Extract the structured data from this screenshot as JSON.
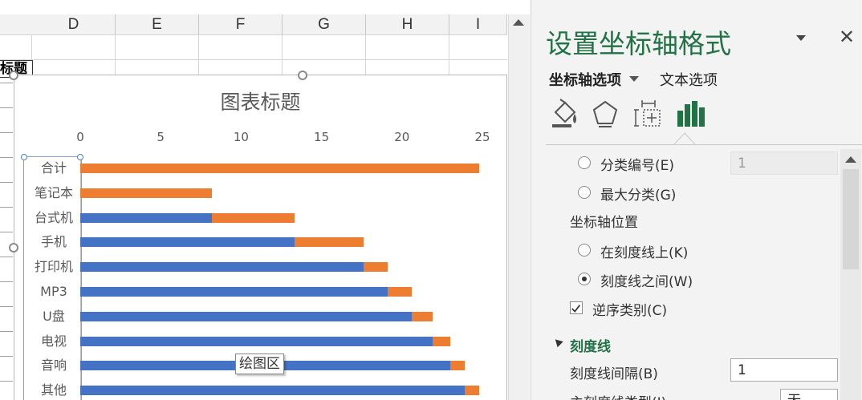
{
  "sheet": {
    "columns": [
      "D",
      "E",
      "F",
      "G",
      "H",
      "I"
    ],
    "cut_cell_text": "标题"
  },
  "chart": {
    "title": "图表标题",
    "tooltip": "绘图区",
    "colors": {
      "series1": "#4472c4",
      "series2": "#ed7d31"
    }
  },
  "chart_data": {
    "type": "bar",
    "orientation": "horizontal",
    "stacked": true,
    "title": "图表标题",
    "categories": [
      "合计",
      "笔记本",
      "台式机",
      "手机",
      "打印机",
      "MP3",
      "U盘",
      "电视",
      "音响",
      "其他"
    ],
    "series": [
      {
        "values": [
          0,
          0,
          8.2,
          13.3,
          17.6,
          19.1,
          20.6,
          21.9,
          23.0,
          23.9
        ]
      },
      {
        "values": [
          24.8,
          8.2,
          5.1,
          4.3,
          1.5,
          1.5,
          1.3,
          1.1,
          0.9,
          0.9
        ]
      }
    ],
    "xlim": [
      0,
      25
    ],
    "xticks": [
      "0",
      "5",
      "10",
      "15",
      "20",
      "25"
    ],
    "reverse_categories": true
  },
  "pane": {
    "title": "设置坐标轴格式",
    "tab_axis": "坐标轴选项",
    "tab_text": "文本选项",
    "icons": [
      "fill-line-icon",
      "effects-icon",
      "size-properties-icon",
      "axis-options-icon"
    ],
    "accent": "#217346",
    "options": {
      "category_number_label": "分类编号(E)",
      "category_number_value": "1",
      "max_category_label": "最大分类(G)",
      "axis_position_section": "坐标轴位置",
      "on_tick_marks_label": "在刻度线上(K)",
      "between_tick_marks_label": "刻度线之间(W)",
      "reverse_order_label": "逆序类别(C)",
      "tick_marks_section": "刻度线",
      "tick_interval_label": "刻度线间隔(B)",
      "tick_interval_value": "1",
      "major_tick_type_label": "主刻度线类型(J)",
      "major_tick_type_value": "无"
    }
  }
}
